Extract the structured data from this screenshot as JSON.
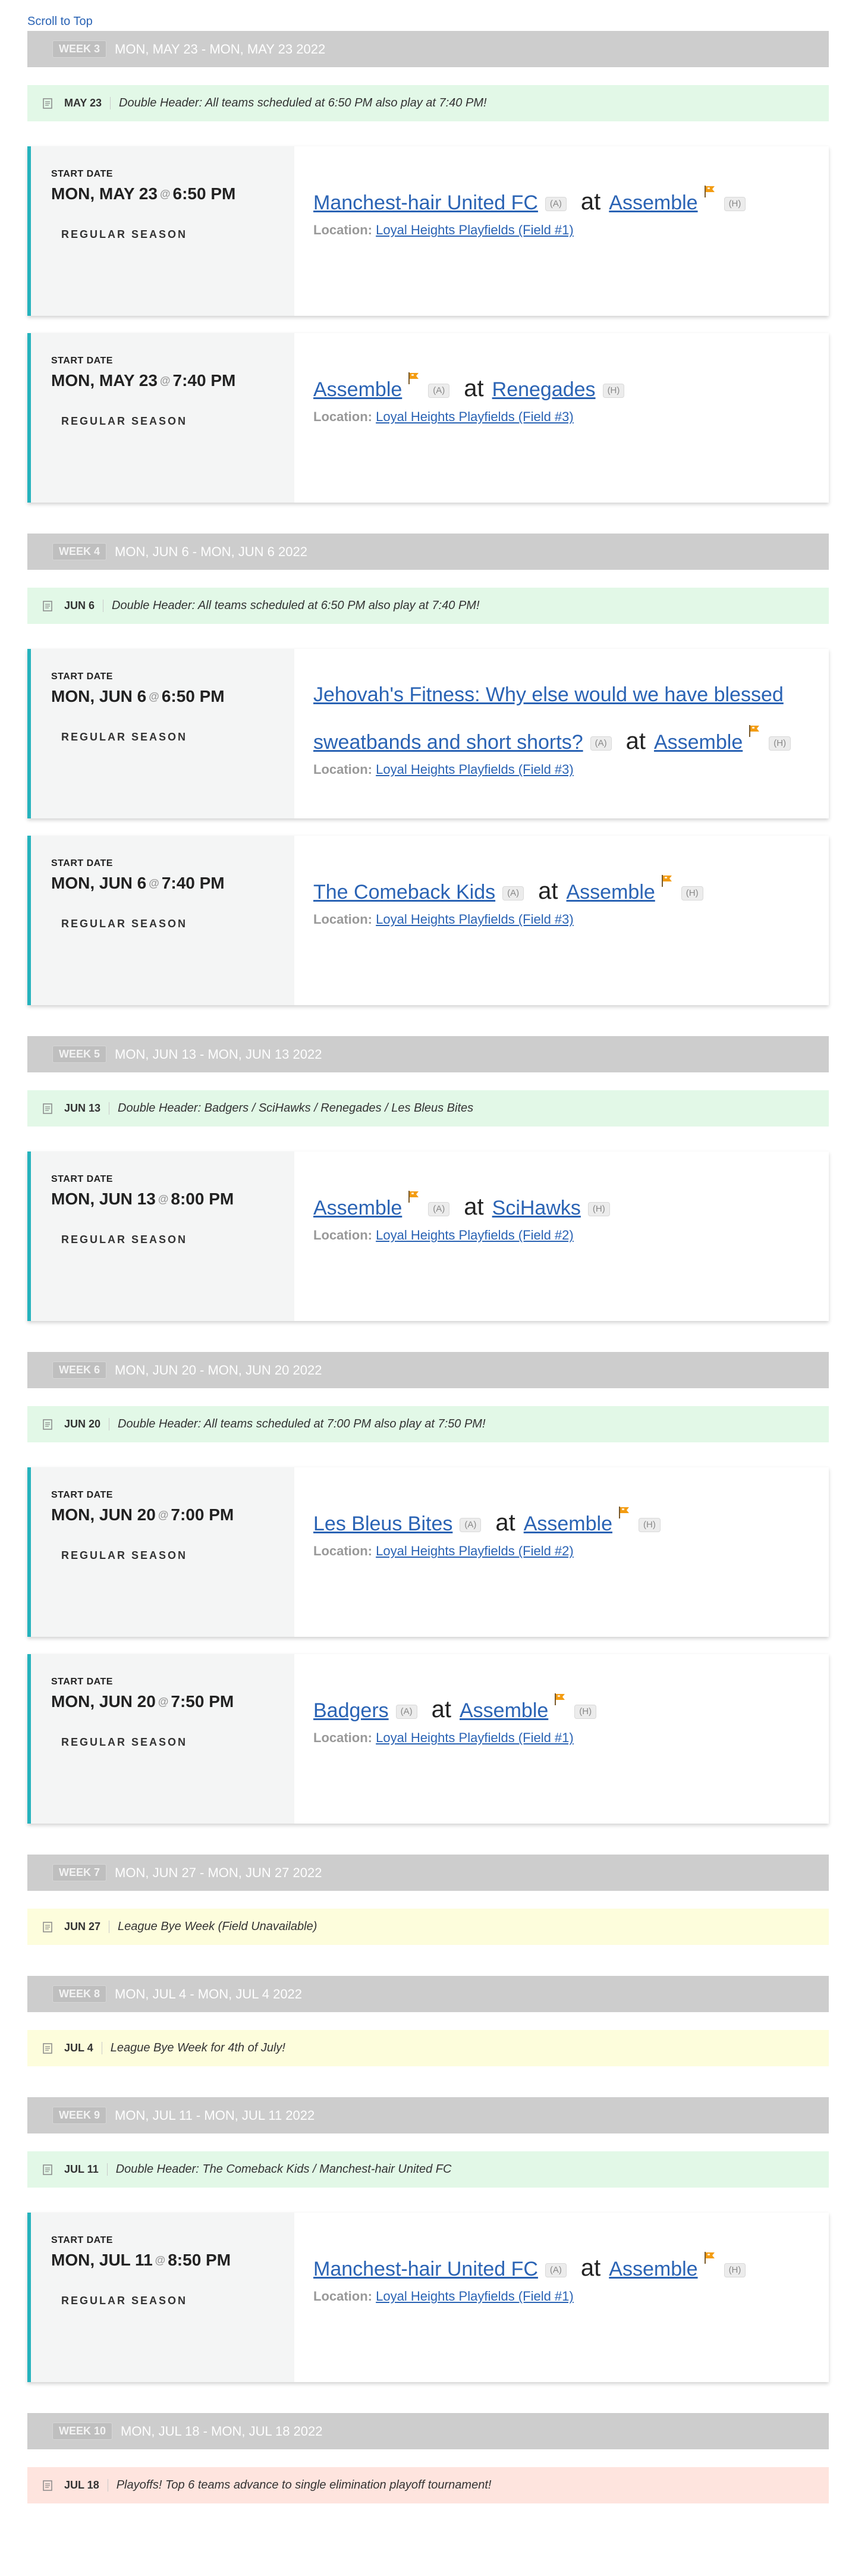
{
  "scroll_top": "Scroll to Top",
  "labels": {
    "start_date": "START DATE",
    "location": "Location:",
    "at": "at",
    "away": "(A)",
    "home": "(H)"
  },
  "colors": {
    "accent": "#26b3bd",
    "link": "#2a63b4",
    "note_green": "#e2f8e7",
    "note_yellow": "#fdfddc",
    "note_red": "#fee4de"
  },
  "weeks": [
    {
      "badge": "WEEK 3",
      "range": "MON, MAY 23 - MON, MAY 23 2022",
      "note": {
        "date": "MAY 23",
        "text": "Double Header: All teams scheduled at 6:50 PM also play at 7:40 PM!"
      },
      "games": [
        {
          "date": "MON, MAY 23",
          "time": "6:50 PM",
          "season": "REGULAR SEASON",
          "away": "Manchest-hair United FC",
          "home": "Assemble",
          "location": "Loyal Heights Playfields (Field #1)"
        },
        {
          "date": "MON, MAY 23",
          "time": "7:40 PM",
          "season": "REGULAR SEASON",
          "away": "Assemble",
          "home": "Renegades",
          "location": "Loyal Heights Playfields (Field #3)"
        }
      ]
    },
    {
      "badge": "WEEK 4",
      "range": "MON, JUN 6 - MON, JUN 6 2022",
      "note": {
        "date": "JUN 6",
        "text": "Double Header: All teams scheduled at 6:50 PM also play at 7:40 PM!"
      },
      "games": [
        {
          "date": "MON, JUN 6",
          "time": "6:50 PM",
          "season": "REGULAR SEASON",
          "away": "Jehovah's Fitness: Why else would we have blessed sweatbands and short shorts?",
          "home": "Assemble",
          "location": "Loyal Heights Playfields (Field #3)"
        },
        {
          "date": "MON, JUN 6",
          "time": "7:40 PM",
          "season": "REGULAR SEASON",
          "away": "The Comeback Kids",
          "home": "Assemble",
          "location": "Loyal Heights Playfields (Field #3)"
        }
      ]
    },
    {
      "badge": "WEEK 5",
      "range": "MON, JUN 13 - MON, JUN 13 2022",
      "note": {
        "date": "JUN 13",
        "text": "Double Header: Badgers / SciHawks / Renegades / Les Bleus Bites"
      },
      "games": [
        {
          "date": "MON, JUN 13",
          "time": "8:00 PM",
          "season": "REGULAR SEASON",
          "away": "Assemble",
          "home": "SciHawks",
          "location": "Loyal Heights Playfields (Field #2)"
        }
      ]
    },
    {
      "badge": "WEEK 6",
      "range": "MON, JUN 20 - MON, JUN 20 2022",
      "note": {
        "date": "JUN 20",
        "text": "Double Header: All teams scheduled at 7:00 PM also play at 7:50 PM!"
      },
      "games": [
        {
          "date": "MON, JUN 20",
          "time": "7:00 PM",
          "season": "REGULAR SEASON",
          "away": "Les Bleus Bites",
          "home": "Assemble",
          "location": "Loyal Heights Playfields (Field #2)"
        },
        {
          "date": "MON, JUN 20",
          "time": "7:50 PM",
          "season": "REGULAR SEASON",
          "away": "Badgers",
          "home": "Assemble",
          "location": "Loyal Heights Playfields (Field #1)"
        }
      ]
    },
    {
      "badge": "WEEK 7",
      "range": "MON, JUN 27 - MON, JUN 27 2022",
      "note": {
        "date": "JUN 27",
        "text": "League Bye Week (Field Unavailable)"
      },
      "games": []
    },
    {
      "badge": "WEEK 8",
      "range": "MON, JUL 4 - MON, JUL 4 2022",
      "note": {
        "date": "JUL 4",
        "text": "League Bye Week for 4th of July!"
      },
      "games": []
    },
    {
      "badge": "WEEK 9",
      "range": "MON, JUL 11 - MON, JUL 11 2022",
      "note": {
        "date": "JUL 11",
        "text": "Double Header: The Comeback Kids / Manchest-hair United FC"
      },
      "games": [
        {
          "date": "MON, JUL 11",
          "time": "8:50 PM",
          "season": "REGULAR SEASON",
          "away": "Manchest-hair United FC",
          "home": "Assemble",
          "location": "Loyal Heights Playfields (Field #1)"
        }
      ]
    },
    {
      "badge": "WEEK 10",
      "range": "MON, JUL 18 - MON, JUL 18 2022",
      "note": {
        "date": "JUL 18",
        "text": "Playoffs! Top 6 teams advance to single elimination playoff tournament!"
      },
      "games": []
    }
  ]
}
